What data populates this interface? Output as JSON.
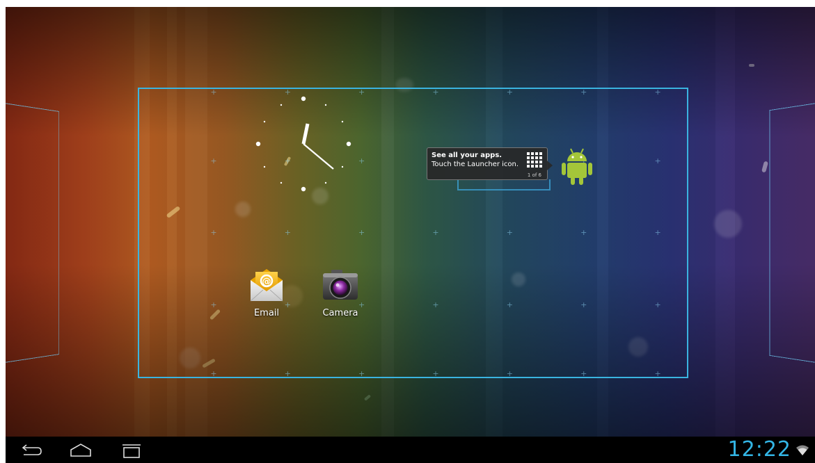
{
  "home_screen": {
    "apps": [
      {
        "label": "Email",
        "icon": "email-icon"
      },
      {
        "label": "Camera",
        "icon": "camera-icon"
      }
    ],
    "hint": {
      "title": "See all your apps.",
      "text": "Touch the Launcher icon.",
      "page": "1 of 6"
    }
  },
  "status_bar": {
    "time": "12:22",
    "wifi_icon": "wifi-icon"
  },
  "nav": {
    "back_icon": "back-icon",
    "home_icon": "home-icon",
    "recents_icon": "recent-apps-icon"
  },
  "colors": {
    "accent": "#33b5e5"
  }
}
